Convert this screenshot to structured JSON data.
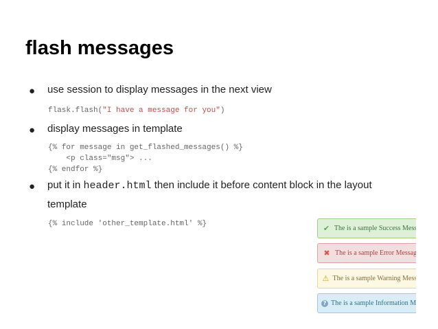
{
  "slide": {
    "title": "flash messages",
    "bullets": [
      {
        "text": "use session to display messages in the next view"
      },
      {
        "text": "display messages in template"
      },
      {
        "text_before": "put it in ",
        "inline_code": "header.html",
        "text_after": " then include it before content block in the layout",
        "text_line2": "template"
      }
    ],
    "code_flash": {
      "prefix": "flask.flash(",
      "string": "\"I have a message for you\"",
      "suffix": ")"
    },
    "code_template": [
      "{% for message in get_flashed_messages() %}",
      "    <p class=\"msg\"> ...",
      "{% endfor %}"
    ],
    "code_include": "{% include 'other_template.html' %}"
  },
  "alerts": [
    {
      "icon": "check-icon",
      "text": "The is a sample Success Message"
    },
    {
      "icon": "cross-icon",
      "text": "The is a sample Error Message"
    },
    {
      "icon": "warning-icon",
      "text": "The is a sample Warning Message"
    },
    {
      "icon": "info-icon",
      "text": "The is a sample Information Message"
    }
  ]
}
